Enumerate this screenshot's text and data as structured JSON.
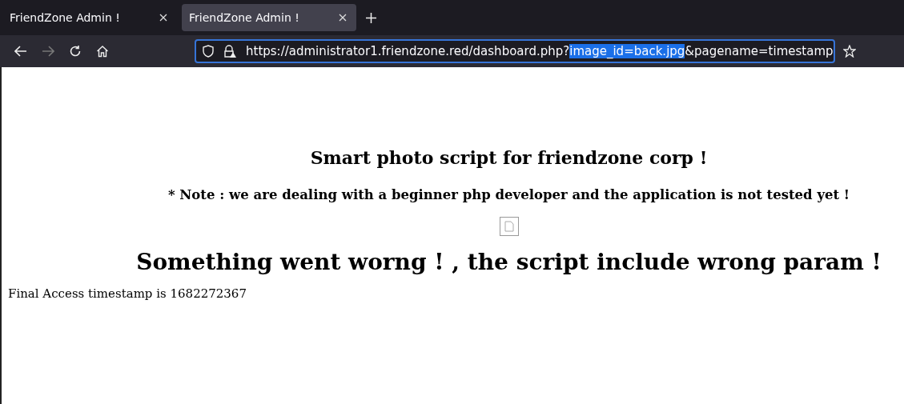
{
  "tabs": [
    {
      "label": "FriendZone Admin !",
      "selected": false
    },
    {
      "label": "FriendZone Admin !",
      "selected": true
    }
  ],
  "address_bar": {
    "url_before": "https://administrator1.friendzone.red/dashboard.php?",
    "url_selected": "image_id=back.jpg",
    "url_after": "&pagename=timestamp"
  },
  "page": {
    "title": "Smart photo script for friendzone corp !",
    "note": "* Note : we are dealing with a beginner php developer and the application is not tested yet !",
    "error": "Something went worng ! , the script include wrong param !",
    "timestamp": "Final Access timestamp is 1682272367"
  }
}
